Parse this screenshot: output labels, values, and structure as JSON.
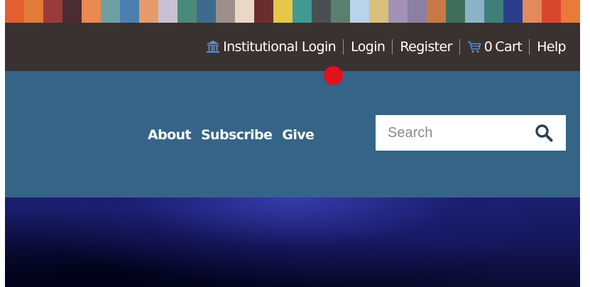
{
  "stripe_colors": [
    "#e35f32",
    "#e07b39",
    "#9b3a3a",
    "#4b2c33",
    "#e98a4f",
    "#6e9fa3",
    "#4c7fb0",
    "#e59c6a",
    "#c8c0d4",
    "#4a8a78",
    "#3d6b8f",
    "#9a8f8a",
    "#e7d9c3",
    "#6b2c2e",
    "#e5c84a",
    "#3f9b92",
    "#4a4f52",
    "#5a7f6c",
    "#b8d3ea",
    "#d7c17a",
    "#a492b6",
    "#8a7fa4",
    "#c77a45",
    "#3e6f5d",
    "#8ab4c6",
    "#3e7f7a",
    "#2a3e8e",
    "#e38a5a",
    "#d9472f",
    "#e87a3a"
  ],
  "utility_nav": {
    "institutional_login": "Institutional Login",
    "login": "Login",
    "register": "Register",
    "cart_count": "0",
    "cart_label": "Cart",
    "help": "Help",
    "icons": {
      "institution": "bank-icon",
      "cart": "cart-icon"
    }
  },
  "main_nav": {
    "items": [
      "About",
      "Subscribe",
      "Give"
    ]
  },
  "search": {
    "placeholder": "Search",
    "icon": "search-icon"
  },
  "colors": {
    "utility_bar": "#3a3230",
    "header": "#356487",
    "click_marker": "#e0121b"
  }
}
